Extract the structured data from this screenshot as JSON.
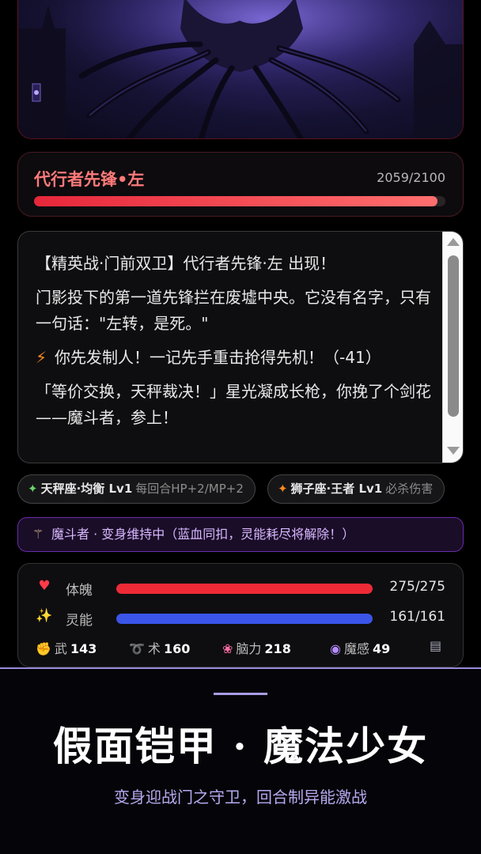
{
  "enemy": {
    "name": "代行者先锋•左",
    "hp_text": "2059/2100",
    "hp_current": 2059,
    "hp_max": 2100,
    "hp_color": "#e7273a"
  },
  "log": {
    "lines": [
      "【精英战·门前双卫】代行者先锋·左 出现！",
      "门影投下的第一道先锋拦在废墟中央。它没有名字，只有一句话：\"左转，是死。\"",
      "你先发制人！一记先手重击抢得先机！（-41）",
      "「等价交换，天秤裁决！」星光凝成长枪，你挽了个剑花——魔斗者，参上！"
    ],
    "line3_icon": "lightning-icon"
  },
  "skills": [
    {
      "icon": "sparkle-green-icon",
      "name": "天秤座·均衡 Lv1",
      "desc": "每回合HP+2/MP+2"
    },
    {
      "icon": "sparkle-orange-icon",
      "name": "狮子座·王者 Lv1",
      "desc": "必杀伤害"
    }
  ],
  "status": {
    "icon": "magic-wand-icon",
    "text": "魔斗者 · 变身维持中（蓝血同扣，灵能耗尽将解除！）"
  },
  "player": {
    "hp": {
      "icon": "heart-icon",
      "label": "体魄",
      "value": "275/275",
      "fraction": 1.0,
      "color": "#ee2a36"
    },
    "mp": {
      "icon": "sparkles-icon",
      "label": "灵能",
      "value": "161/161",
      "fraction": 1.0,
      "color": "#3a55e8"
    },
    "attrs": [
      {
        "icon": "fist-icon",
        "label": "武",
        "value": "143"
      },
      {
        "icon": "spiral-icon",
        "label": "术",
        "value": "160"
      },
      {
        "icon": "brain-icon",
        "label": "脑力",
        "value": "218"
      },
      {
        "icon": "crystal-ball-icon",
        "label": "魔感",
        "value": "49"
      }
    ]
  },
  "promo": {
    "title": "假面铠甲 · 魔法少女",
    "subtitle": "变身迎战门之守卫，回合制异能激战"
  }
}
